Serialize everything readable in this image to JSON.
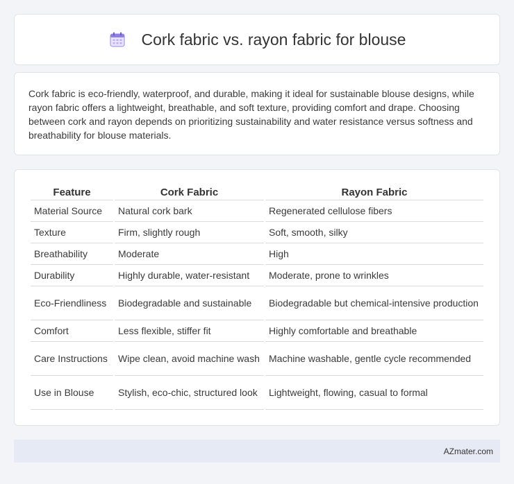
{
  "header": {
    "title": "Cork fabric vs. rayon fabric for blouse",
    "icon": "calendar-icon"
  },
  "summary": {
    "text": "Cork fabric is eco-friendly, waterproof, and durable, making it ideal for sustainable blouse designs, while rayon fabric offers a lightweight, breathable, and soft texture, providing comfort and drape. Choosing between cork and rayon depends on prioritizing sustainability and water resistance versus softness and breathability for blouse materials."
  },
  "table": {
    "headers": [
      "Feature",
      "Cork Fabric",
      "Rayon Fabric"
    ],
    "rows": [
      [
        "Material Source",
        "Natural cork bark",
        "Regenerated cellulose fibers"
      ],
      [
        "Texture",
        "Firm, slightly rough",
        "Soft, smooth, silky"
      ],
      [
        "Breathability",
        "Moderate",
        "High"
      ],
      [
        "Durability",
        "Highly durable, water-resistant",
        "Moderate, prone to wrinkles"
      ],
      [
        "Eco-Friendliness",
        "Biodegradable and sustainable",
        "Biodegradable but chemical-intensive production"
      ],
      [
        "Comfort",
        "Less flexible, stiffer fit",
        "Highly comfortable and breathable"
      ],
      [
        "Care Instructions",
        "Wipe clean, avoid machine wash",
        "Machine washable, gentle cycle recommended"
      ],
      [
        "Use in Blouse",
        "Stylish, eco-chic, structured look",
        "Lightweight, flowing, casual to formal"
      ]
    ]
  },
  "footer": {
    "text": "AZmater.com"
  }
}
